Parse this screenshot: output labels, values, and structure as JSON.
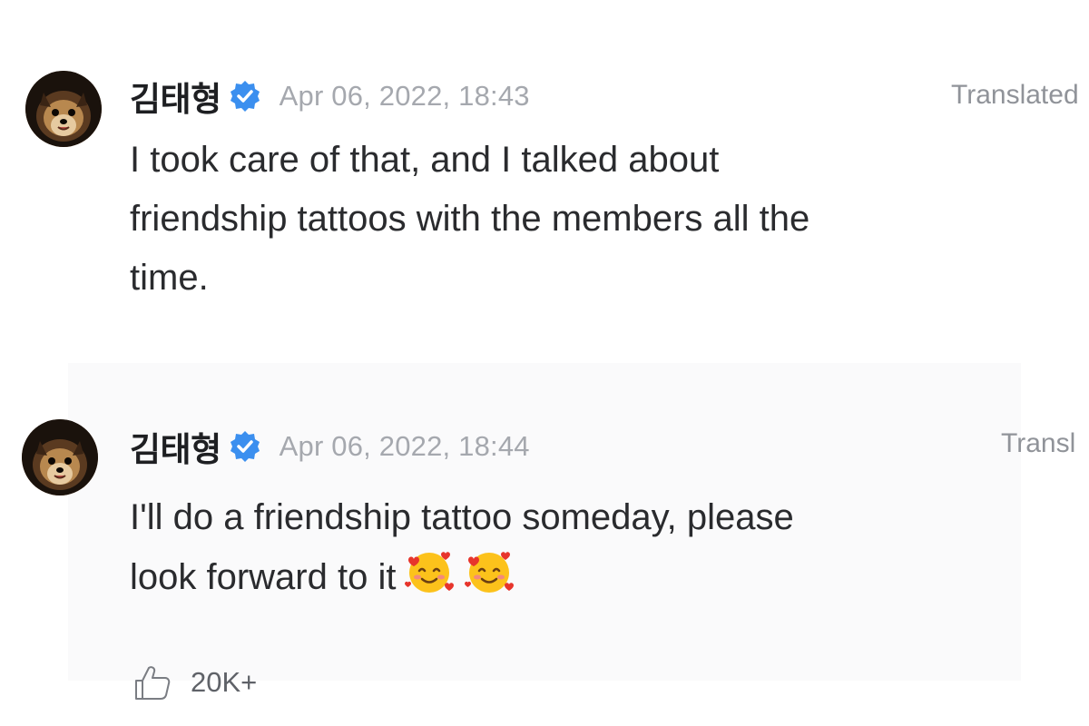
{
  "comments": [
    {
      "username": "김태형",
      "timestamp": "Apr 06, 2022, 18:43",
      "translate_label": "Translated",
      "text": "I took care of that, and I talked about\nfriendship tattoos with the members all the\ntime."
    },
    {
      "username": "김태형",
      "timestamp": "Apr 06, 2022, 18:44",
      "translate_label": "Transl",
      "text": "I'll do a friendship tattoo someday, please\nlook forward to it",
      "emojis": [
        "smiling-face-with-hearts",
        "smiling-face-with-hearts"
      ],
      "likes": "20K+"
    }
  ],
  "colors": {
    "verified": "#3b8fef",
    "timestamp": "#a5a8ae",
    "text": "#2a2b2e"
  }
}
